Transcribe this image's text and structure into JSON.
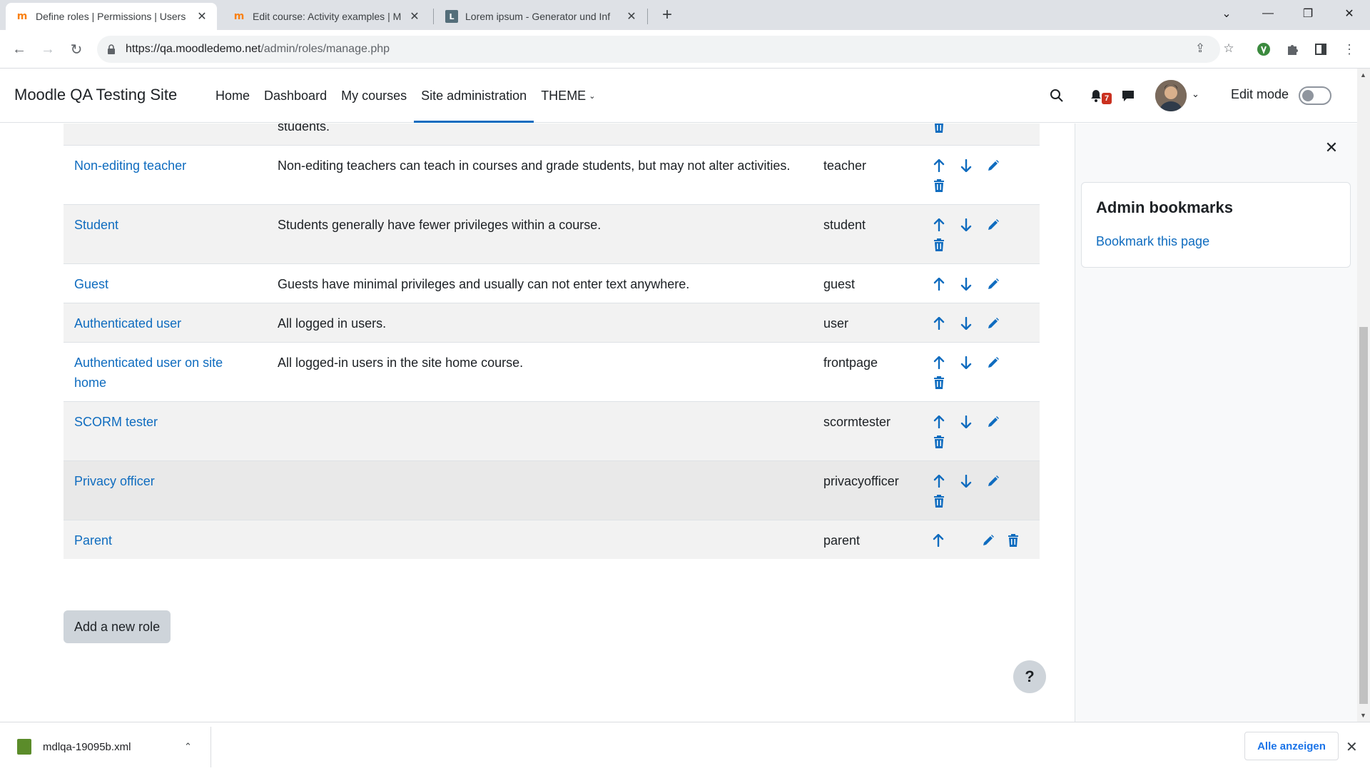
{
  "browser": {
    "tabs": [
      {
        "title": "Define roles | Permissions | Users",
        "active": true,
        "icon": "moodle-icon"
      },
      {
        "title": "Edit course: Activity examples | M",
        "active": false,
        "icon": "moodle-icon"
      },
      {
        "title": "Lorem ipsum - Generator und Inf",
        "active": false,
        "icon": "lorem-icon"
      }
    ],
    "url_host": "https://qa.moodledemo.net",
    "url_path": "/admin/roles/manage.php"
  },
  "header": {
    "site_name": "Moodle QA Testing Site",
    "nav": [
      {
        "label": "Home",
        "active": false
      },
      {
        "label": "Dashboard",
        "active": false
      },
      {
        "label": "My courses",
        "active": false
      },
      {
        "label": "Site administration",
        "active": true
      },
      {
        "label": "THEME",
        "active": false,
        "dropdown": true
      }
    ],
    "notification_count": "7",
    "edit_mode_label": "Edit mode",
    "edit_mode_on": false
  },
  "roles_table": {
    "partial_row": {
      "description": "students."
    },
    "rows": [
      {
        "name": "Non-editing teacher",
        "description": "Non-editing teachers can teach in courses and grade students, but may not alter activities.",
        "shortname": "teacher",
        "up": true,
        "down": true,
        "delete_wrapped": true
      },
      {
        "name": "Student",
        "description": "Students generally have fewer privileges within a course.",
        "shortname": "student",
        "up": true,
        "down": true,
        "delete_wrapped": true
      },
      {
        "name": "Guest",
        "description": "Guests have minimal privileges and usually can not enter text anywhere.",
        "shortname": "guest",
        "up": true,
        "down": true,
        "delete_wrapped": false,
        "no_delete": true
      },
      {
        "name": "Authenticated user",
        "description": "All logged in users.",
        "shortname": "user",
        "up": true,
        "down": true,
        "delete_wrapped": false,
        "no_delete": true
      },
      {
        "name": "Authenticated user on site home",
        "description": "All logged-in users in the site home course.",
        "shortname": "frontpage",
        "up": true,
        "down": true,
        "delete_wrapped": true
      },
      {
        "name": "SCORM tester",
        "description": "",
        "shortname": "scormtester",
        "up": true,
        "down": true,
        "delete_wrapped": true
      },
      {
        "name": "Privacy officer",
        "description": "",
        "shortname": "privacyofficer",
        "up": true,
        "down": true,
        "delete_wrapped": true
      },
      {
        "name": "Parent",
        "description": "",
        "shortname": "parent",
        "up": true,
        "down": false,
        "delete_wrapped": false
      }
    ]
  },
  "add_role_label": "Add a new role",
  "help_label": "?",
  "drawer": {
    "title": "Admin bookmarks",
    "link": "Bookmark this page"
  },
  "downloads": {
    "filename": "mdlqa-19095b.xml",
    "show_all": "Alle anzeigen"
  },
  "colors": {
    "link": "#0f6cbf",
    "accent": "#0f6cbf",
    "badge": "#ca3120"
  }
}
